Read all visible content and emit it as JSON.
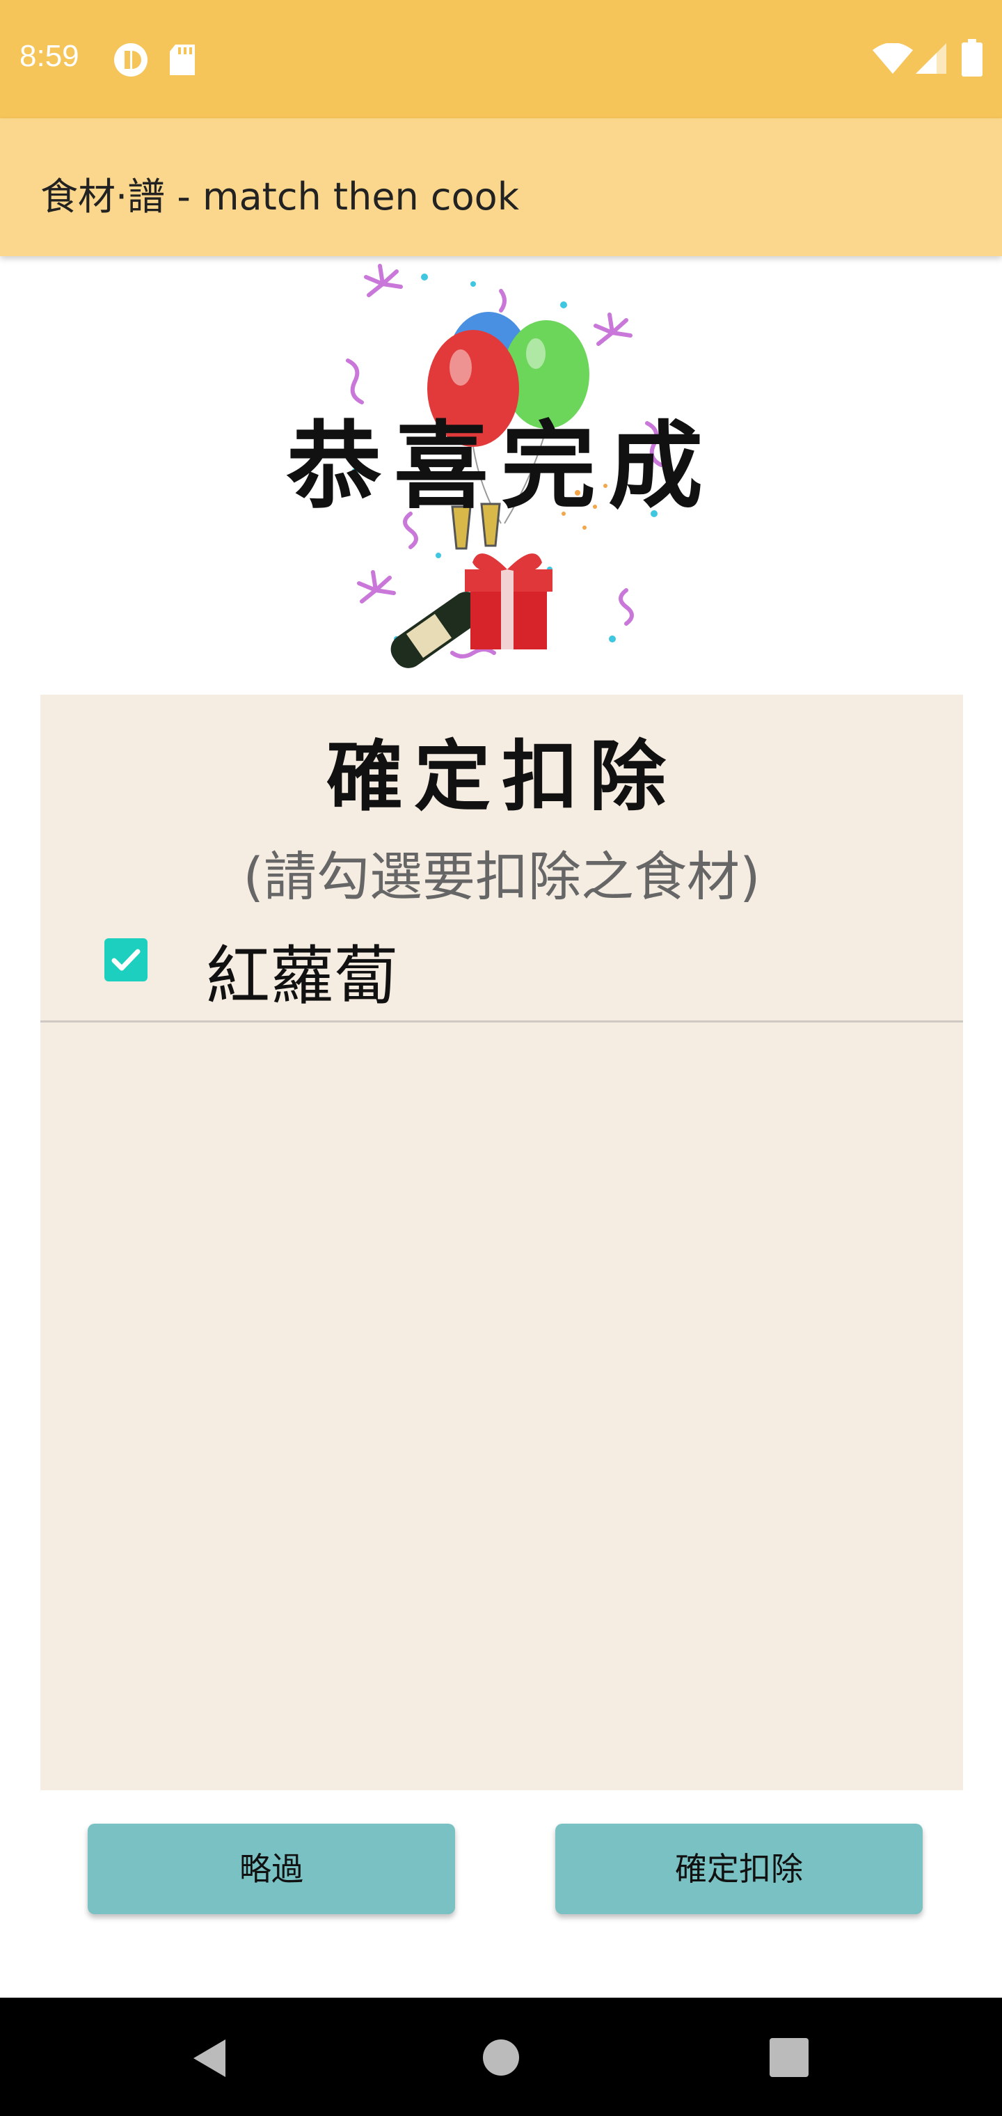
{
  "status_bar": {
    "time": "8:59",
    "icons": [
      "app-notification-icon",
      "sd-card-icon",
      "wifi-icon",
      "cell-signal-icon",
      "battery-icon"
    ]
  },
  "app_bar": {
    "title": "食材·譜 - match then cook"
  },
  "celebration": {
    "title": "恭喜完成",
    "image": "celebration-balloons-champagne-gift"
  },
  "deduct_panel": {
    "title": "確定扣除",
    "subtitle": "(請勾選要扣除之食材)",
    "items": [
      {
        "label": "紅蘿蔔",
        "checked": true
      }
    ]
  },
  "buttons": {
    "skip": "略過",
    "confirm": "確定扣除"
  },
  "nav_bar": {
    "icons": [
      "back-icon",
      "home-icon",
      "recents-icon"
    ]
  },
  "colors": {
    "status_bar": "#f6c55a",
    "app_bar": "#fad78c",
    "panel": "#f5ece2",
    "button": "#79c1c2",
    "checkbox": "#1dcfbe"
  }
}
